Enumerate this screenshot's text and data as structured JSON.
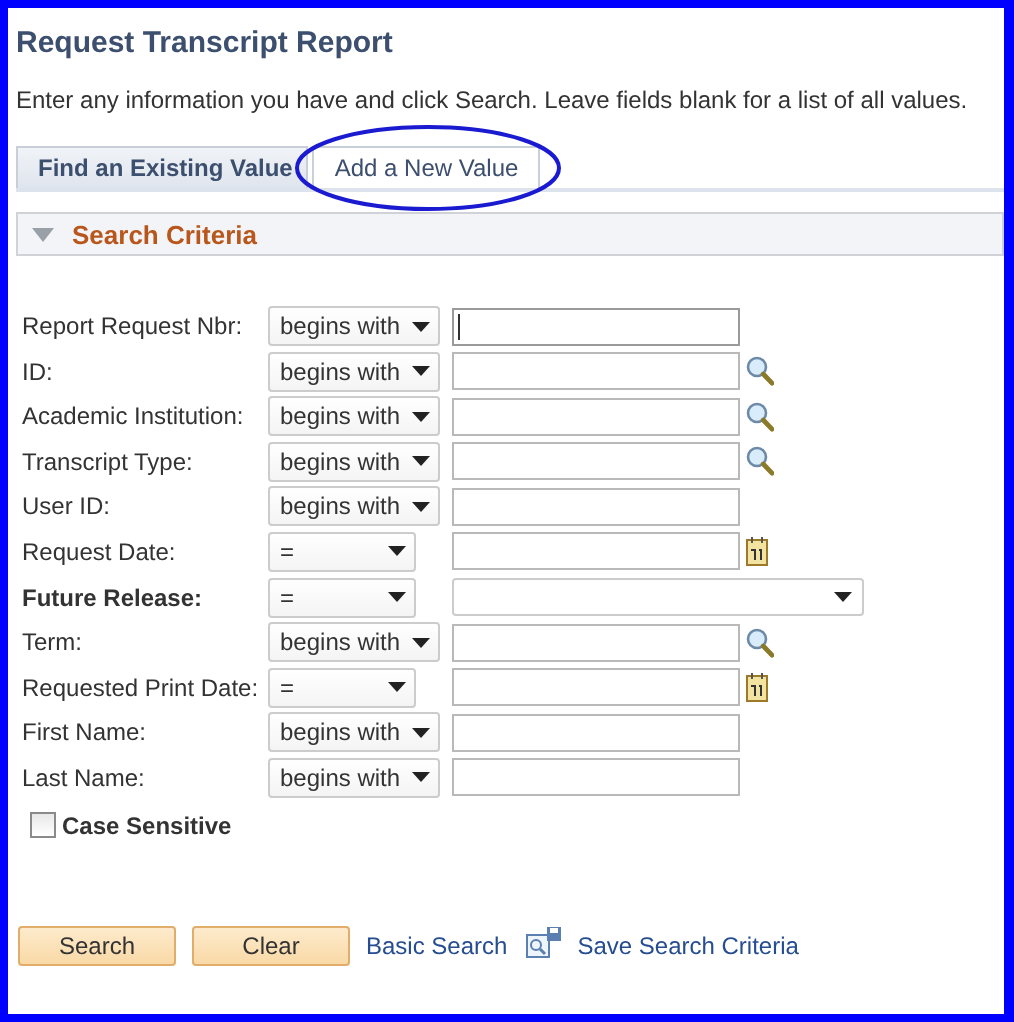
{
  "page": {
    "title": "Request Transcript Report",
    "instructions": "Enter any information you have and click Search. Leave fields blank for a list of all values."
  },
  "tabs": [
    {
      "label": "Find an Existing Value",
      "selected": true,
      "highlighted": false
    },
    {
      "label": "Add a New Value",
      "selected": false,
      "highlighted": true
    }
  ],
  "section": {
    "title": "Search Criteria",
    "expanded": true
  },
  "fields": [
    {
      "label": "Report Request Nbr:",
      "bold": false,
      "operator": "begins with",
      "kind": "text",
      "focused": true
    },
    {
      "label": "ID:",
      "bold": false,
      "operator": "begins with",
      "kind": "lookup",
      "focused": false
    },
    {
      "label": "Academic Institution:",
      "bold": false,
      "operator": "begins with",
      "kind": "lookup",
      "focused": false
    },
    {
      "label": "Transcript Type:",
      "bold": false,
      "operator": "begins with",
      "kind": "lookup",
      "focused": false
    },
    {
      "label": "User ID:",
      "bold": false,
      "operator": "begins with",
      "kind": "text",
      "focused": false
    },
    {
      "label": "Request Date:",
      "bold": false,
      "operator": "=",
      "kind": "date",
      "focused": false
    },
    {
      "label": "Future Release:",
      "bold": true,
      "operator": "=",
      "kind": "dropdown"
    },
    {
      "label": "Term:",
      "bold": false,
      "operator": "begins with",
      "kind": "lookup",
      "focused": false
    },
    {
      "label": "Requested Print Date:",
      "bold": false,
      "operator": "=",
      "kind": "date",
      "focused": false
    },
    {
      "label": "First Name:",
      "bold": false,
      "operator": "begins with",
      "kind": "text",
      "focused": false
    },
    {
      "label": "Last Name:",
      "bold": false,
      "operator": "begins with",
      "kind": "text",
      "focused": false
    }
  ],
  "case_sensitive": {
    "label": "Case Sensitive",
    "checked": false
  },
  "buttons": [
    "Search",
    "Clear"
  ],
  "links": [
    {
      "label": "Basic Search",
      "kind": "plain"
    },
    {
      "label": "Save Search Criteria",
      "kind": "save"
    }
  ]
}
